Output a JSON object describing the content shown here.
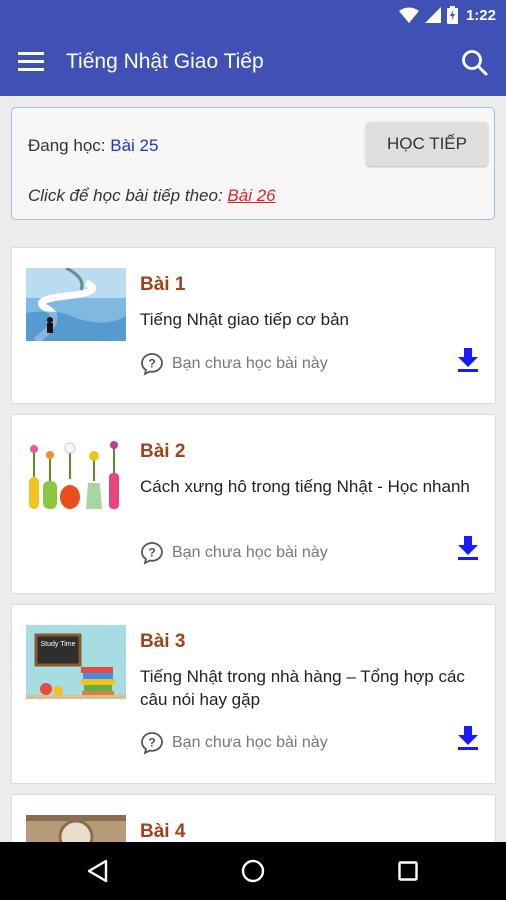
{
  "status_bar": {
    "time": "1:22"
  },
  "app_bar": {
    "title": "Tiếng Nhật Giao Tiếp"
  },
  "progress": {
    "current_label": "Đang học: ",
    "current_lesson": "Bài 25",
    "continue_button": "HỌC TIẾP",
    "next_label": "Click để học bài tiếp theo: ",
    "next_lesson": "Bài 26"
  },
  "lessons": [
    {
      "number": "Bài 1",
      "title": "Tiếng Nhật giao tiếp cơ bản",
      "status": "Bạn chưa học bài này"
    },
    {
      "number": "Bài 2",
      "title": "Cách xưng hô trong tiếng Nhật - Học nhanh",
      "status": "Bạn chưa học bài này"
    },
    {
      "number": "Bài 3",
      "title": "Tiếng Nhật trong nhà hàng – Tổng hợp các câu nói hay gặp",
      "status": "Bạn chưa học bài này"
    },
    {
      "number": "Bài 4"
    }
  ],
  "thumbnails": {
    "lesson3_board_text": "Study Time"
  },
  "colors": {
    "primary": "#3f51b5",
    "lesson_number": "#a0421c",
    "link_blue": "#1a36c7",
    "next_link_red": "#e42323",
    "download_icon": "#1a1aff"
  },
  "icons": {
    "menu": "menu-icon",
    "search": "search-icon",
    "status": "question-bubble-icon",
    "download": "download-icon"
  }
}
